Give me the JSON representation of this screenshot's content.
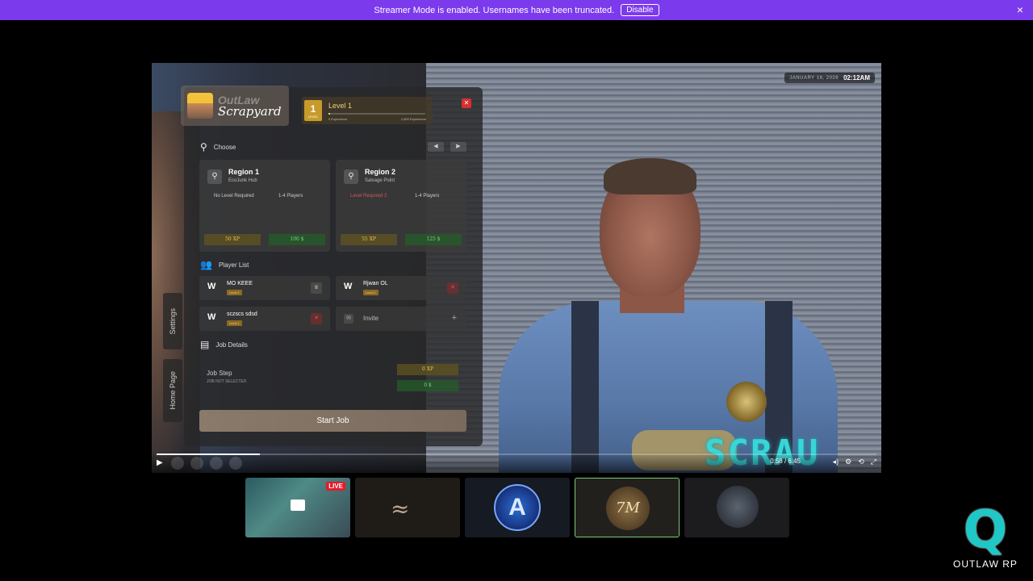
{
  "banner": {
    "message": "Streamer Mode is enabled. Usernames have been truncated.",
    "disable_label": "Disable",
    "close_icon": "×"
  },
  "video": {
    "date": "JANUARY 16, 2026",
    "time": "02:12AM",
    "watermark": "SCRAU",
    "timecode": "0:58 / 6:45",
    "progress": 0.144
  },
  "panel": {
    "brand_top": "OutLaw",
    "brand_bottom": "Scrapyard",
    "level": {
      "number": "1",
      "number_label": "LEVEL",
      "title": "Level 1",
      "xp_left": "0 Experience",
      "xp_right": "1,600 Experience",
      "progress": 0.02
    },
    "close_label": "✕",
    "choose_label": "Choose",
    "regions": [
      {
        "name": "Region 1",
        "sub": "EcoJunk Hub",
        "req": "No Level Required",
        "locked": false,
        "players": "1-4 Players",
        "xp": "50 XP",
        "money": "100 $"
      },
      {
        "name": "Region 2",
        "sub": "Salvage Point",
        "req": "Level Required 2",
        "locked": true,
        "players": "1-4 Players",
        "xp": "55 XP",
        "money": "125 $"
      }
    ],
    "player_list_label": "Player List",
    "players": [
      {
        "name": "MO KEEE",
        "level": "Level 1"
      },
      {
        "name": "Rjwan OL",
        "level": "Level 1"
      },
      {
        "name": "sczscs sdsd",
        "level": "Level 1"
      }
    ],
    "invite_label": "Invite",
    "job_details_label": "Job Details",
    "job_step_label": "Job Step",
    "job_step_value": "JOB NOT SELECTED",
    "job_xp": "0 XP",
    "job_money": "0 $",
    "start_label": "Start Job"
  },
  "side_tabs": {
    "settings": "Settings",
    "home": "Home Page"
  },
  "thumbnails": {
    "live_label": "LIVE",
    "thumb4_mark": "7M"
  },
  "logo": {
    "mark": "Q",
    "text": "OUTLAW RP"
  }
}
